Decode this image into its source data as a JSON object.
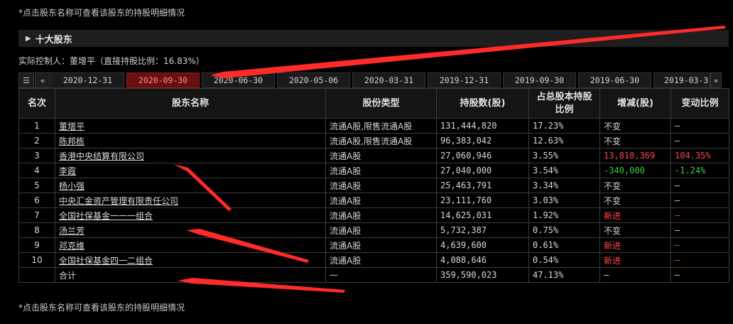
{
  "note_text": "*点击股东名称可查看该股东的持股明细情况",
  "section_title": "十大股东",
  "controller_text": "实际控制人：董增平（直接持股比例：16.83%）",
  "tabs": [
    {
      "label": "2020-12-31",
      "active": false
    },
    {
      "label": "2020-09-30",
      "active": true
    },
    {
      "label": "2020-06-30",
      "active": false
    },
    {
      "label": "2020-05-06",
      "active": false
    },
    {
      "label": "2020-03-31",
      "active": false
    },
    {
      "label": "2019-12-31",
      "active": false
    },
    {
      "label": "2019-09-30",
      "active": false
    },
    {
      "label": "2019-06-30",
      "active": false
    },
    {
      "label": "2019-03-3",
      "active": false
    }
  ],
  "headers": [
    "名次",
    "股东名称",
    "股份类型",
    "持股数(股)",
    "占总股本持股比例",
    "增减(股)",
    "变动比例"
  ],
  "rows": [
    {
      "rank": "1",
      "name": "董增平",
      "type": "流通A股,限售流通A股",
      "shares": "131,444,820",
      "pct": "17.23%",
      "change": "不变",
      "change_color": "default",
      "ratio": "—",
      "ratio_color": "default"
    },
    {
      "rank": "2",
      "name": "陈邦栋",
      "type": "流通A股,限售流通A股",
      "shares": "96,383,042",
      "pct": "12.63%",
      "change": "不变",
      "change_color": "default",
      "ratio": "—",
      "ratio_color": "default"
    },
    {
      "rank": "3",
      "name": "香港中央结算有限公司",
      "type": "流通A股",
      "shares": "27,060,946",
      "pct": "3.55%",
      "change": "13,818,369",
      "change_color": "red",
      "ratio": "104.35%",
      "ratio_color": "red"
    },
    {
      "rank": "4",
      "name": "李霞",
      "type": "流通A股",
      "shares": "27,040,000",
      "pct": "3.54%",
      "change": "-340,000",
      "change_color": "green",
      "ratio": "-1.24%",
      "ratio_color": "green"
    },
    {
      "rank": "5",
      "name": "杨小强",
      "type": "流通A股",
      "shares": "25,463,791",
      "pct": "3.34%",
      "change": "不变",
      "change_color": "default",
      "ratio": "—",
      "ratio_color": "default"
    },
    {
      "rank": "6",
      "name": "中央汇金资产管理有限责任公司",
      "type": "流通A股",
      "shares": "23,111,760",
      "pct": "3.03%",
      "change": "不变",
      "change_color": "default",
      "ratio": "—",
      "ratio_color": "default"
    },
    {
      "rank": "7",
      "name": "全国社保基金一一一组合",
      "type": "流通A股",
      "shares": "14,625,031",
      "pct": "1.92%",
      "change": "新进",
      "change_color": "red",
      "ratio": "—",
      "ratio_color": "red"
    },
    {
      "rank": "8",
      "name": "汤兰芳",
      "type": "流通A股",
      "shares": "5,732,387",
      "pct": "0.75%",
      "change": "不变",
      "change_color": "default",
      "ratio": "—",
      "ratio_color": "default"
    },
    {
      "rank": "9",
      "name": "邓克维",
      "type": "流通A股",
      "shares": "4,639,600",
      "pct": "0.61%",
      "change": "新进",
      "change_color": "red",
      "ratio": "—",
      "ratio_color": "red"
    },
    {
      "rank": "10",
      "name": "全国社保基金四一二组合",
      "type": "流通A股",
      "shares": "4,088,646",
      "pct": "0.54%",
      "change": "新进",
      "change_color": "red",
      "ratio": "—",
      "ratio_color": "red"
    }
  ],
  "total_row": {
    "label": "合计",
    "type": "—",
    "shares": "359,590,023",
    "pct": "47.13%",
    "change": "—",
    "ratio": "—"
  },
  "colors": {
    "active_tab_bg": "#6a0f0f",
    "active_tab_text": "#ff8a8a",
    "increase": "#ff4646",
    "decrease": "#3ecc3e",
    "annotation_arrow": "#ff2a2a"
  }
}
